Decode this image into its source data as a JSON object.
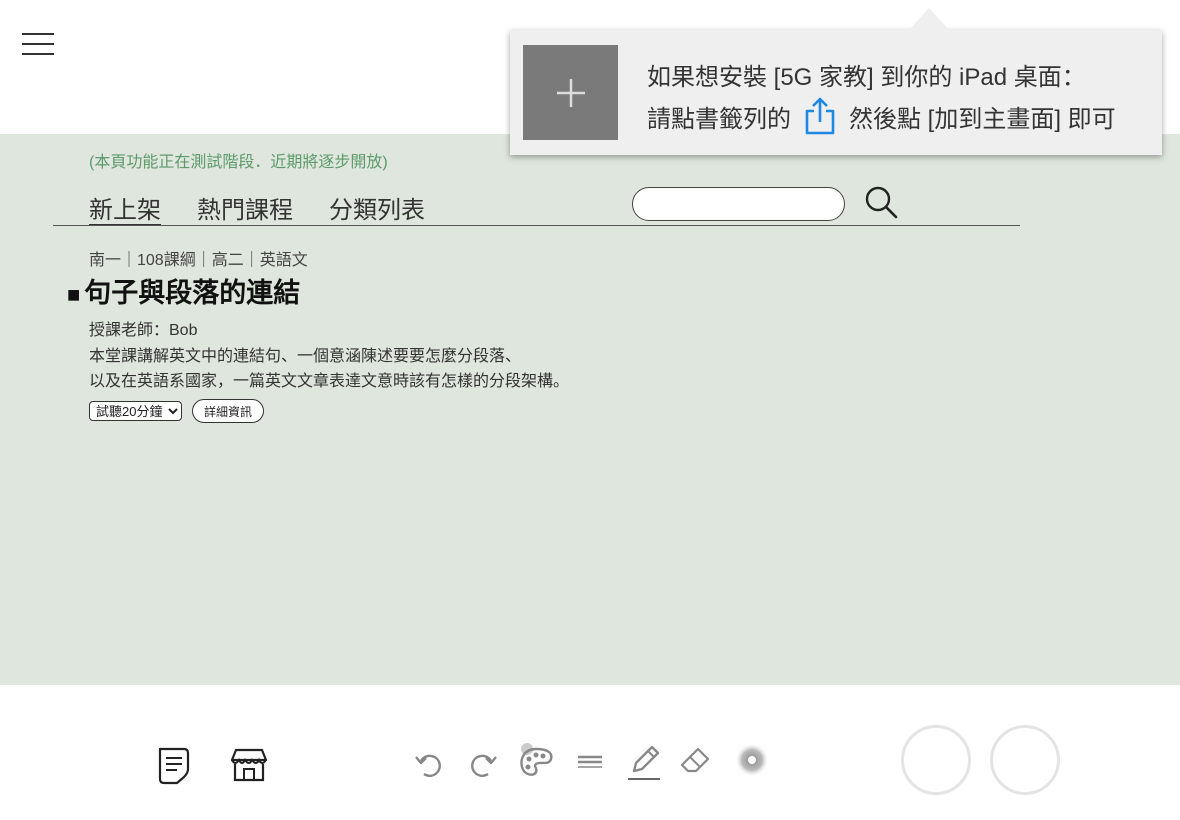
{
  "main": {
    "beta_note": "(本頁功能正在測試階段．近期將逐步開放)",
    "tabs": [
      {
        "label": "新上架",
        "active": true
      },
      {
        "label": "熱門課程",
        "active": false
      },
      {
        "label": "分類列表",
        "active": false
      }
    ],
    "search": {
      "placeholder": "",
      "value": ""
    }
  },
  "course": {
    "breadcrumb": "南一｜108課綱｜高二｜英語文",
    "title": "句子與段落的連結",
    "teacher": "授課老師：Bob",
    "desc_line1": "本堂課講解英文中的連結句、一個意涵陳述要要怎麼分段落、",
    "desc_line2": "以及在英語系國家，一篇英文文章表達文意時該有怎樣的分段架構。",
    "trial_option": "試聽20分鐘",
    "detail_label": "詳細資訊"
  },
  "popup": {
    "line1": "如果想安裝 [5G 家教] 到你的 iPad 桌面：",
    "line2_before": "請點書籤列的",
    "line2_after": "然後點 [加到主畫面] 即可"
  },
  "colors": {
    "panel_bg": "#dfe6dd",
    "beta_note": "#5d9a6b",
    "share_icon": "#1e88e5",
    "popup_bg": "#efefef"
  },
  "toolbar_icons": [
    "notes-icon",
    "store-icon",
    "undo-icon",
    "redo-icon",
    "palette-icon",
    "line-width-icon",
    "pen-icon",
    "eraser-icon",
    "brush-size-icon"
  ]
}
